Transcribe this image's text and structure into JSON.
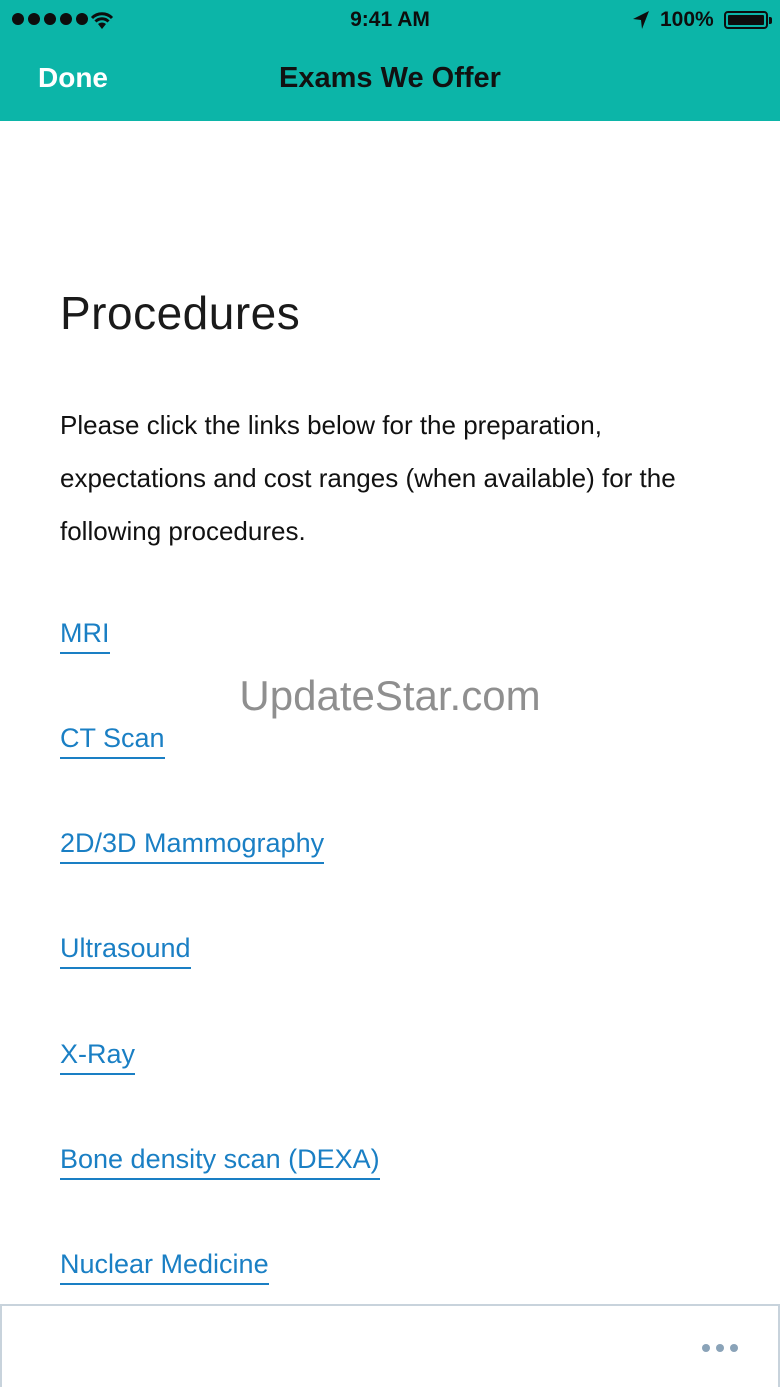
{
  "status_bar": {
    "time": "9:41 AM",
    "battery": "100%",
    "icons": [
      "signal-icon",
      "wifi-icon",
      "location-arrow-icon",
      "battery-icon"
    ]
  },
  "nav": {
    "done_label": "Done",
    "title": "Exams We Offer"
  },
  "page": {
    "heading": "Procedures",
    "intro": "Please click the links below for the preparation, expectations and cost ranges (when available) for the following procedures."
  },
  "procedures": [
    "MRI ",
    "CT Scan ",
    "2D/3D Mammography",
    "Ultrasound",
    "X-Ray",
    "Bone density scan (DEXA)",
    "Nuclear Medicine"
  ],
  "watermark": "UpdateStar.com",
  "toolbar": {
    "more_icon": "more-dots-icon"
  },
  "colors": {
    "nav_background": "#0cb5a8",
    "link": "#1a7fc4",
    "toolbar_border": "#c8d3dc"
  }
}
